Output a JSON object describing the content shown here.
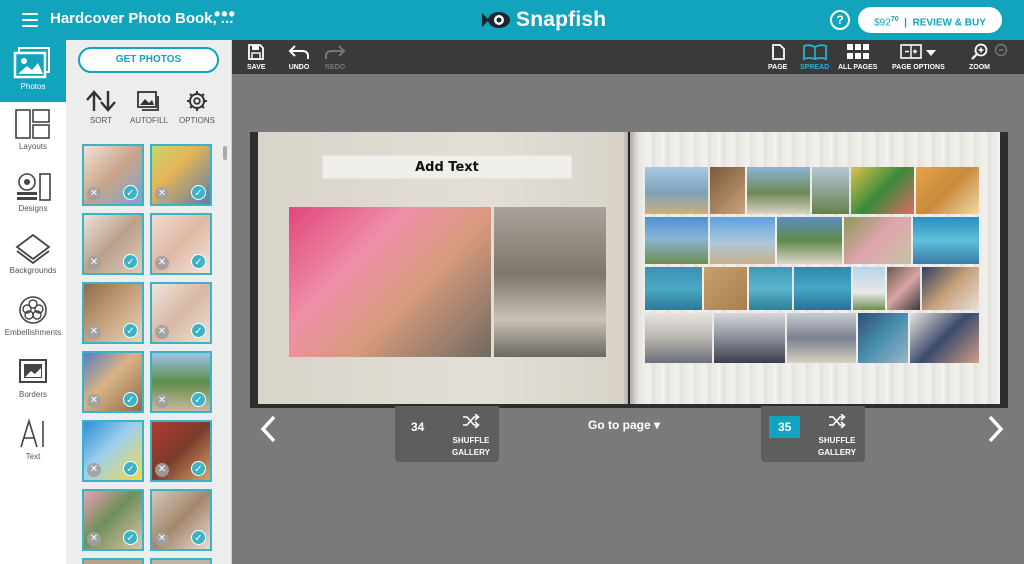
{
  "header": {
    "project_title": "Hardcover Photo Book, ...",
    "more_label": "•••",
    "logo_text": "Snapfish",
    "help_label": "?",
    "price": "$92",
    "price_cents": "70",
    "buy_label": "REVIEW & BUY"
  },
  "rail": {
    "items": [
      {
        "label": "Photos",
        "icon": "photos-icon"
      },
      {
        "label": "Layouts",
        "icon": "layouts-icon"
      },
      {
        "label": "Designs",
        "icon": "designs-icon"
      },
      {
        "label": "Backgrounds",
        "icon": "backgrounds-icon"
      },
      {
        "label": "Embellishments",
        "icon": "embellishments-icon"
      },
      {
        "label": "Borders",
        "icon": "borders-icon"
      },
      {
        "label": "Text",
        "icon": "text-icon"
      }
    ],
    "active": "Photos"
  },
  "panel": {
    "get_photos_label": "GET PHOTOS",
    "tools": [
      {
        "label": "SORT",
        "icon": "sort-icon"
      },
      {
        "label": "AUTOFILL",
        "icon": "autofill-icon"
      },
      {
        "label": "OPTIONS",
        "icon": "gear-icon"
      }
    ],
    "remove_glyph": "✕",
    "check_glyph": "✓"
  },
  "toolbar": {
    "save_label": "SAVE",
    "undo_label": "UNDO",
    "redo_label": "REDO",
    "page_label": "PAGE",
    "spread_label": "SPREAD",
    "all_pages_label": "ALL PAGES",
    "page_options_label": "PAGE OPTIONS",
    "zoom_label": "ZOOM",
    "active_view": "SPREAD"
  },
  "book": {
    "add_text_label": "Add Text"
  },
  "bottom": {
    "left_page_number": "34",
    "right_page_number": "35",
    "shuffle_line1": "SHUFFLE",
    "shuffle_line2": "GALLERY",
    "goto_label": "Go to page",
    "goto_caret": "▾"
  },
  "colors": {
    "accent": "#12a3bd",
    "toolbar_bg": "#3a3a3a",
    "canvas_bg": "#7a7a7a"
  }
}
